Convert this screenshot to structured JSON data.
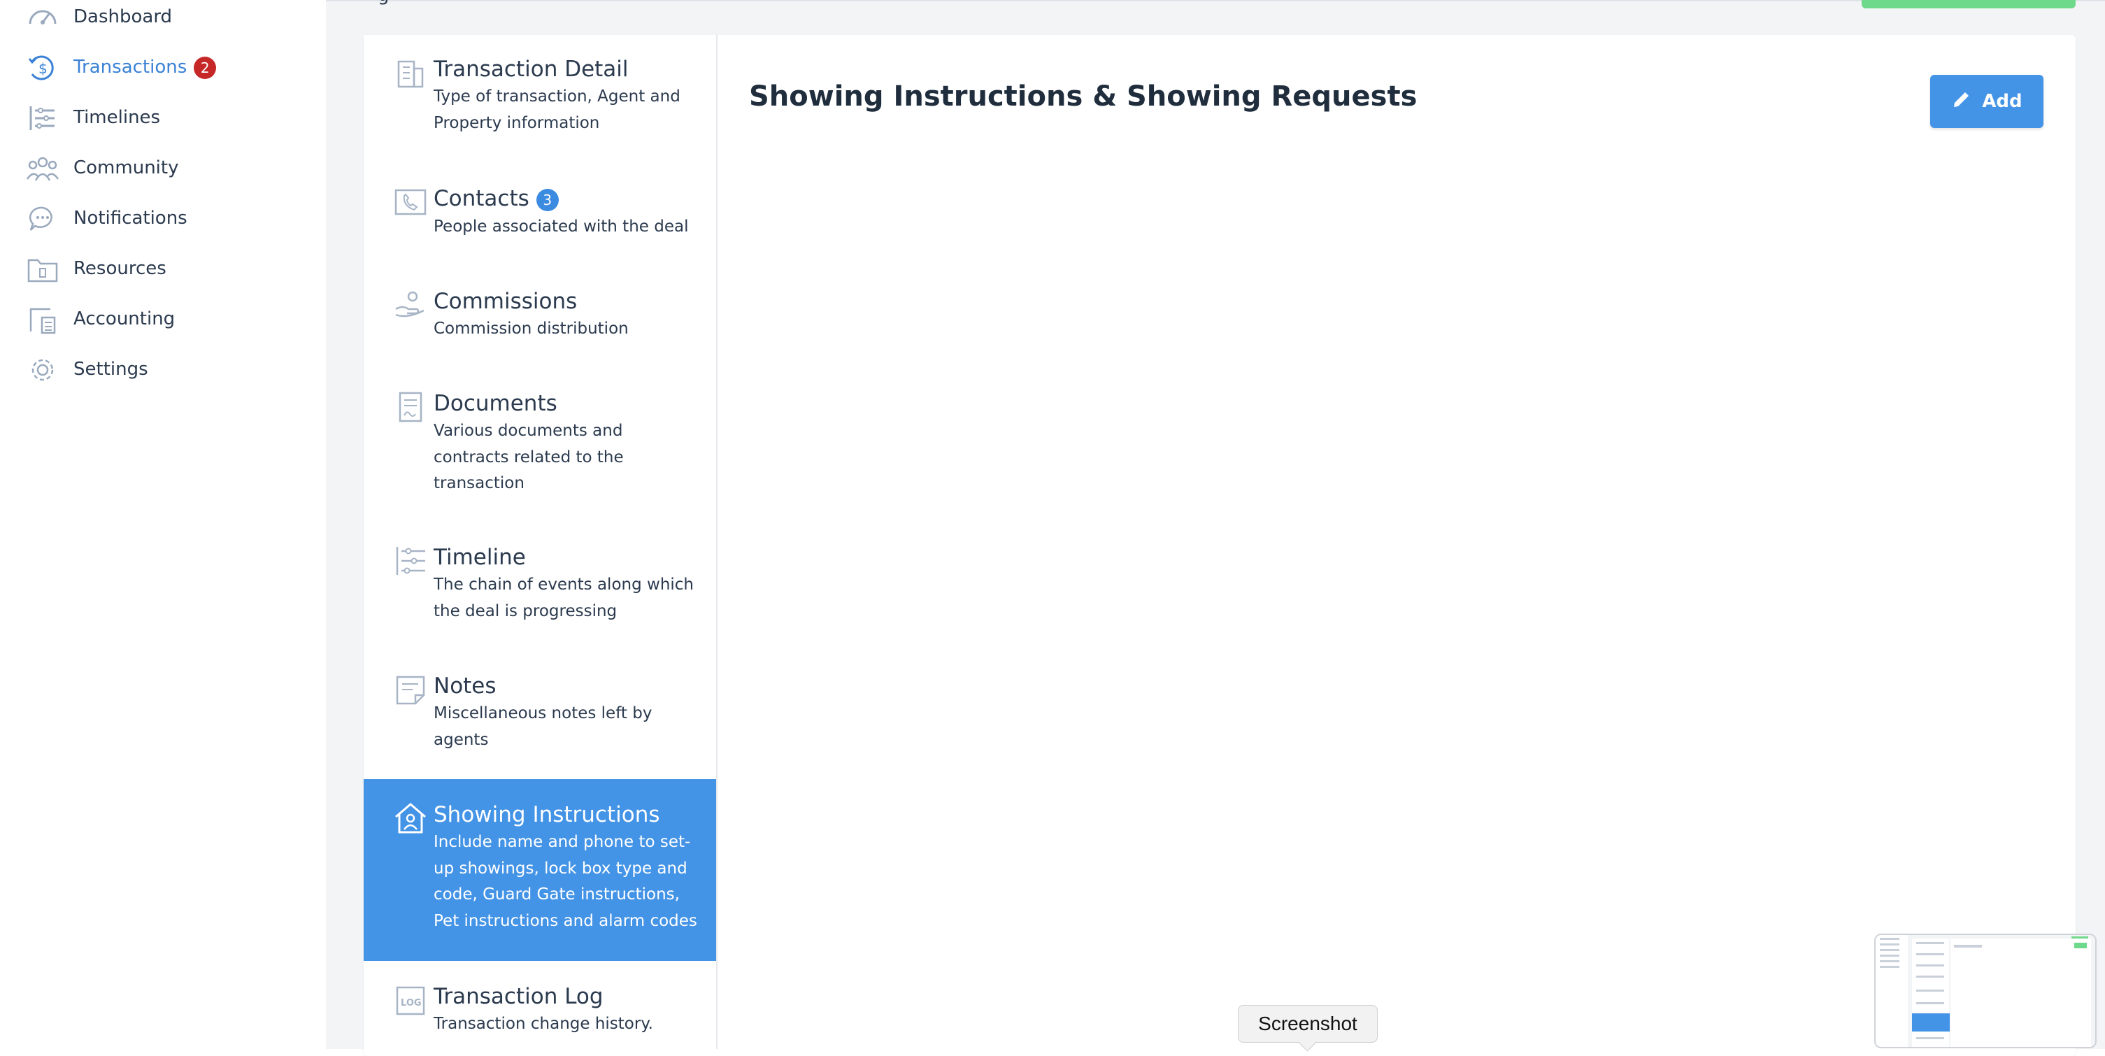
{
  "sidebar": {
    "items": [
      {
        "label": "Dashboard",
        "icon": "gauge-icon"
      },
      {
        "label": "Transactions",
        "icon": "dollar-cycle-icon",
        "badge": "2",
        "active": true
      },
      {
        "label": "Timelines",
        "icon": "timeline-icon"
      },
      {
        "label": "Community",
        "icon": "users-icon"
      },
      {
        "label": "Notifications",
        "icon": "chat-bubble-icon"
      },
      {
        "label": "Resources",
        "icon": "folder-icon"
      },
      {
        "label": "Accounting",
        "icon": "calculator-icon"
      },
      {
        "label": "Settings",
        "icon": "gear-icon"
      }
    ]
  },
  "tabs": [
    {
      "title": "Transaction Detail",
      "desc": "Type of transaction, Agent and Property information",
      "icon": "building-icon"
    },
    {
      "title": "Contacts",
      "badge": "3",
      "desc": "People associated with the deal",
      "icon": "phone-book-icon"
    },
    {
      "title": "Commissions",
      "desc": "Commission distribution",
      "icon": "hand-coin-icon"
    },
    {
      "title": "Documents",
      "desc": "Various documents and contracts related to the transaction",
      "icon": "document-icon"
    },
    {
      "title": "Timeline",
      "desc": "The chain of events along which the deal is progressing",
      "icon": "timeline-icon"
    },
    {
      "title": "Notes",
      "desc": "Miscellaneous notes left by agents",
      "icon": "note-icon"
    },
    {
      "title": "Showing Instructions",
      "desc": "Include name and phone to set-up showings, lock box type and code, Guard Gate instructions, Pet instructions and alarm codes",
      "icon": "house-user-icon",
      "active": true
    },
    {
      "title": "Transaction Log",
      "desc": "Transaction change history.",
      "icon": "log-icon"
    }
  ],
  "main": {
    "title": "Showing Instructions & Showing Requests",
    "add_label": "Add",
    "top_cut_text": "g"
  },
  "overlay": {
    "tooltip": "Screenshot"
  },
  "colors": {
    "accent": "#4393e6",
    "badge_red": "#c62828",
    "top_green": "#6ed98b"
  }
}
